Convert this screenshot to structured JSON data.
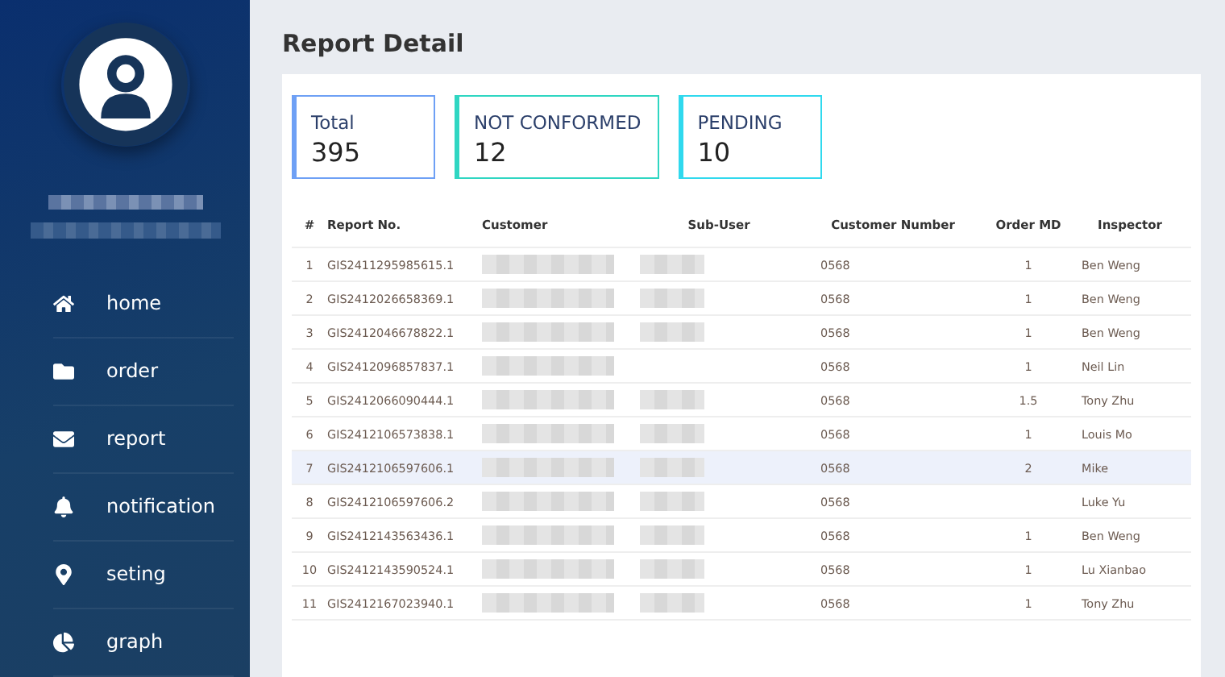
{
  "sidebar": {
    "user_name_blurred": true,
    "user_email_blurred": true,
    "items": [
      {
        "label": "home",
        "selected": false
      },
      {
        "label": "order",
        "selected": false
      },
      {
        "label": "report",
        "selected": false
      },
      {
        "label": "notification",
        "selected": false
      },
      {
        "label": "seting",
        "selected": false
      },
      {
        "label": "graph",
        "selected": false
      }
    ]
  },
  "page": {
    "title": "Report Detail"
  },
  "stats": [
    {
      "label": "Total",
      "value": "395",
      "color": "#6ea0f5"
    },
    {
      "label": "NOT CONFORMED",
      "value": "12",
      "color": "#2fd6c2"
    },
    {
      "label": "PENDING",
      "value": "10",
      "color": "#30d9ee"
    }
  ],
  "table": {
    "columns": [
      "#",
      "Report No.",
      "Customer",
      "Sub-User",
      "Customer Number",
      "Order MD",
      "Inspector"
    ],
    "rows": [
      {
        "index": "1",
        "report_no": "GIS2411295985615.1",
        "sub_user_blurred": true,
        "customer_number": "0568",
        "order_md": "1",
        "inspector": "Ben Weng",
        "selected": false
      },
      {
        "index": "2",
        "report_no": "GIS2412026658369.1",
        "sub_user_blurred": true,
        "customer_number": "0568",
        "order_md": "1",
        "inspector": "Ben Weng",
        "selected": false
      },
      {
        "index": "3",
        "report_no": "GIS2412046678822.1",
        "sub_user_blurred": true,
        "customer_number": "0568",
        "order_md": "1",
        "inspector": "Ben Weng",
        "selected": false
      },
      {
        "index": "4",
        "report_no": "GIS2412096857837.1",
        "sub_user_blurred": false,
        "customer_number": "0568",
        "order_md": "1",
        "inspector": "Neil Lin",
        "selected": false
      },
      {
        "index": "5",
        "report_no": "GIS2412066090444.1",
        "sub_user_blurred": true,
        "customer_number": "0568",
        "order_md": "1.5",
        "inspector": "Tony Zhu",
        "selected": false
      },
      {
        "index": "6",
        "report_no": "GIS2412106573838.1",
        "sub_user_blurred": true,
        "customer_number": "0568",
        "order_md": "1",
        "inspector": "Louis Mo",
        "selected": false
      },
      {
        "index": "7",
        "report_no": "GIS2412106597606.1",
        "sub_user_blurred": true,
        "customer_number": "0568",
        "order_md": "2",
        "inspector": "Mike",
        "selected": true
      },
      {
        "index": "8",
        "report_no": "GIS2412106597606.2",
        "sub_user_blurred": true,
        "customer_number": "0568",
        "inspector": "Luke Yu",
        "selected": false
      },
      {
        "index": "9",
        "report_no": "GIS2412143563436.1",
        "sub_user_blurred": true,
        "customer_number": "0568",
        "order_md": "1",
        "inspector": "Ben Weng",
        "selected": false
      },
      {
        "index": "10",
        "report_no": "GIS2412143590524.1",
        "sub_user_blurred": true,
        "customer_number": "0568",
        "order_md": "1",
        "inspector": "Lu Xianbao",
        "selected": false
      },
      {
        "index": "11",
        "report_no": "GIS2412167023940.1",
        "sub_user_blurred": true,
        "customer_number": "0568",
        "order_md": "1",
        "inspector": "Tony Zhu",
        "selected": false
      }
    ]
  }
}
